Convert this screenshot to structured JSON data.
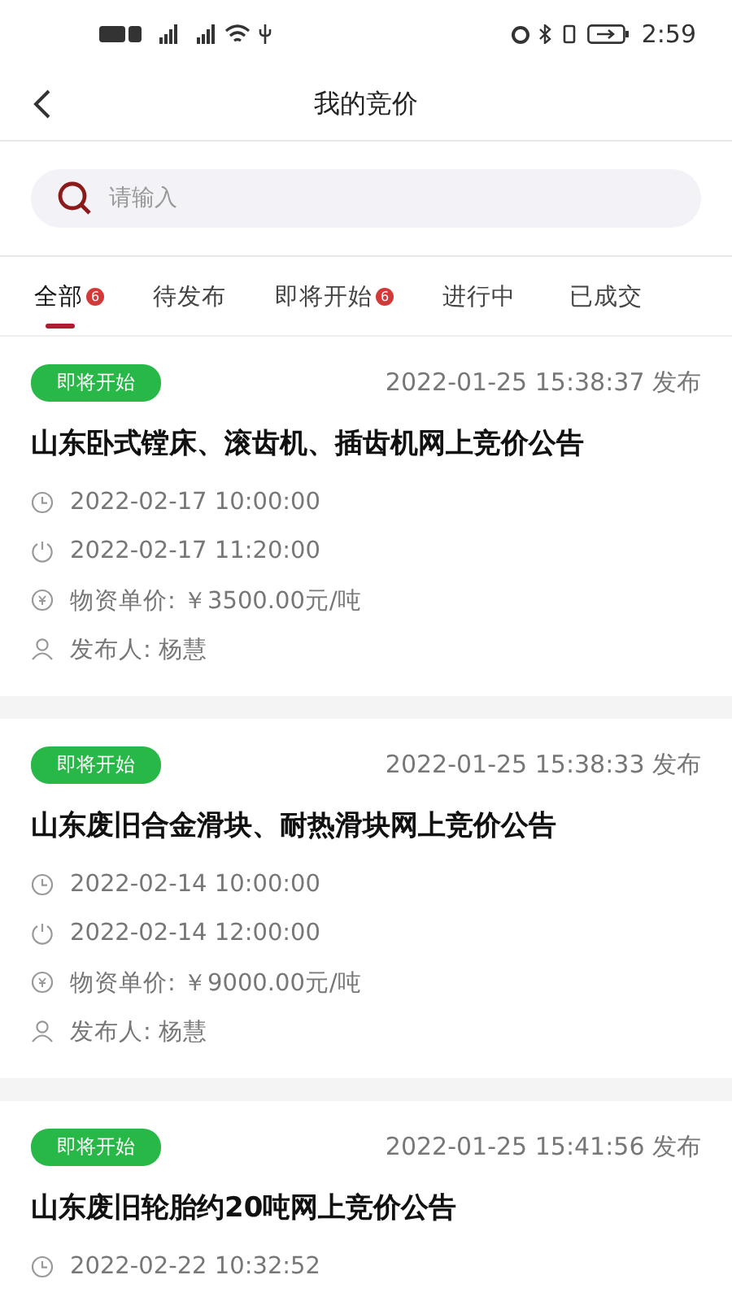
{
  "status_bar": {
    "time": "2:59"
  },
  "header": {
    "title": "我的竞价"
  },
  "search": {
    "placeholder": "请输入"
  },
  "tabs": [
    {
      "label": "全部",
      "badge": "6",
      "selected": true
    },
    {
      "label": "待发布",
      "selected": false
    },
    {
      "label": "即将开始",
      "badge": "6",
      "selected": false
    },
    {
      "label": "进行中",
      "selected": false
    },
    {
      "label": "已成交",
      "selected": false
    }
  ],
  "cards": [
    {
      "status": "即将开始",
      "published": "2022-01-25 15:38:37 发布",
      "title": "山东卧式镗床、滚齿机、插齿机网上竞价公告",
      "rows": [
        {
          "kind": "start",
          "text": "2022-02-17 10:00:00"
        },
        {
          "kind": "end",
          "text": "2022-02-17 11:20:00"
        },
        {
          "kind": "price",
          "text": "物资单价: ￥3500.00元/吨"
        },
        {
          "kind": "publisher",
          "text": "发布人: 杨慧"
        }
      ]
    },
    {
      "status": "即将开始",
      "published": "2022-01-25 15:38:33 发布",
      "title": "山东废旧合金滑块、耐热滑块网上竞价公告",
      "rows": [
        {
          "kind": "start",
          "text": "2022-02-14 10:00:00"
        },
        {
          "kind": "end",
          "text": "2022-02-14 12:00:00"
        },
        {
          "kind": "price",
          "text": "物资单价: ￥9000.00元/吨"
        },
        {
          "kind": "publisher",
          "text": "发布人: 杨慧"
        }
      ]
    },
    {
      "status": "即将开始",
      "published": "2022-01-25 15:41:56 发布",
      "title": "山东废旧轮胎约20吨网上竞价公告",
      "rows": [
        {
          "kind": "start",
          "text": "2022-02-22 10:32:52"
        }
      ]
    }
  ]
}
